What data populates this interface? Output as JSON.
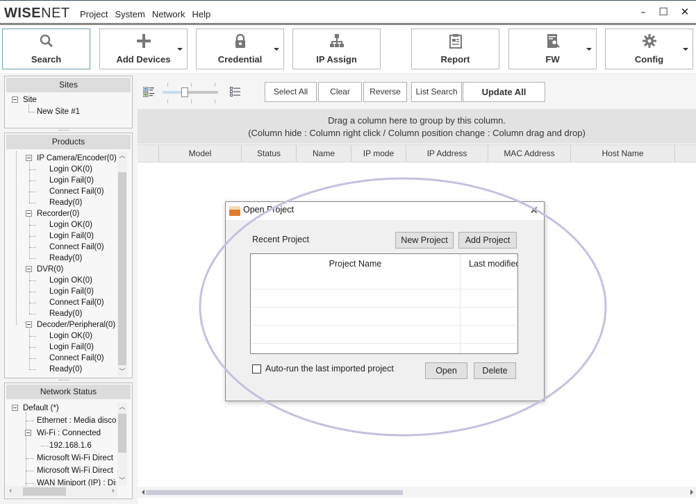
{
  "app": {
    "logo_bold": "WISE",
    "logo_light": "NET",
    "menu": [
      "Project",
      "System",
      "Network",
      "Help"
    ],
    "window_controls": {
      "minimize": "–",
      "maximize": "☐",
      "close": "✕"
    }
  },
  "toolbar": {
    "buttons": [
      {
        "label": "Search",
        "icon": "search-icon",
        "active": true,
        "dropdown": false
      },
      {
        "label": "Add Devices",
        "icon": "plus-icon",
        "active": false,
        "dropdown": true
      },
      {
        "label": "Credential",
        "icon": "lock-icon",
        "active": false,
        "dropdown": true
      },
      {
        "label": "IP Assign",
        "icon": "network-tree-icon",
        "active": false,
        "dropdown": false
      },
      {
        "label": "Report",
        "icon": "clipboard-icon",
        "active": false,
        "dropdown": false
      },
      {
        "label": "FW",
        "icon": "firmware-search-icon",
        "active": false,
        "dropdown": true
      },
      {
        "label": "Config",
        "icon": "gear-icon",
        "active": false,
        "dropdown": true
      }
    ]
  },
  "sites": {
    "title": "Sites",
    "root": "Site",
    "children": [
      "New Site #1"
    ]
  },
  "products": {
    "title": "Products",
    "groups": [
      {
        "label": "IP Camera/Encoder(0)",
        "items": [
          "Login OK(0)",
          "Login Fail(0)",
          "Connect Fail(0)",
          "Ready(0)"
        ]
      },
      {
        "label": "Recorder(0)",
        "items": [
          "Login OK(0)",
          "Login Fail(0)",
          "Connect Fail(0)",
          "Ready(0)"
        ]
      },
      {
        "label": "DVR(0)",
        "items": [
          "Login OK(0)",
          "Login Fail(0)",
          "Connect Fail(0)",
          "Ready(0)"
        ]
      },
      {
        "label": "Decoder/Peripheral(0)",
        "items": [
          "Login OK(0)",
          "Login Fail(0)",
          "Connect Fail(0)",
          "Ready(0)"
        ]
      }
    ]
  },
  "network_status": {
    "title": "Network Status",
    "root": "Default (*)",
    "items": [
      {
        "label": "Ethernet : Media disco",
        "level": 1,
        "expander": false
      },
      {
        "label": "Wi-Fi : Connected",
        "level": 1,
        "expander": true
      },
      {
        "label": "192.168.1.6",
        "level": 2,
        "expander": false
      },
      {
        "label": "Microsoft Wi-Fi Direct",
        "level": 1,
        "expander": false
      },
      {
        "label": "Microsoft Wi-Fi Direct",
        "level": 1,
        "expander": false
      },
      {
        "label": "WAN Miniport (IP) : Dis",
        "level": 1,
        "expander": false
      }
    ]
  },
  "main": {
    "view_size_slider": {
      "value_fraction": 0.4
    },
    "buttons": {
      "select_all": "Select All",
      "clear": "Clear",
      "reverse": "Reverse",
      "list_search": "List Search",
      "update_all": "Update All"
    },
    "group_hint_line1": "Drag a column here to group by this column.",
    "group_hint_line2": "(Column hide : Column right click / Column position change : Column drag and drop)",
    "columns": [
      "",
      "Model",
      "Status",
      "Name",
      "IP mode",
      "IP Address",
      "MAC Address",
      "Host Name",
      ""
    ],
    "rows": []
  },
  "dialog": {
    "title": "Open Project",
    "close": "✕",
    "recent_label": "Recent Project",
    "new_project": "New Project",
    "add_project": "Add Project",
    "grid_columns": [
      "Project Name",
      "Last modified"
    ],
    "grid_rows": [],
    "auto_run_label": "Auto-run the last imported project",
    "auto_run_checked": false,
    "open": "Open",
    "delete": "Delete"
  },
  "colors": {
    "active_border": "#6a9ab0",
    "annotation_ellipse": "#c5c0e0"
  }
}
